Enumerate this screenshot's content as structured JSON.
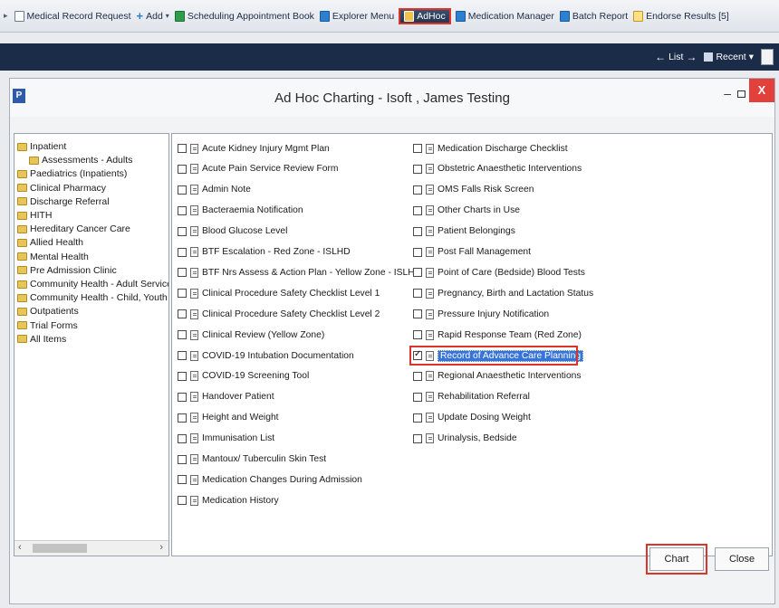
{
  "toolbar": {
    "items": [
      {
        "label": "Medical Record Request",
        "icon": "document-icon"
      },
      {
        "label": "Add",
        "icon": "plus-icon"
      },
      {
        "label": "Scheduling Appointment Book",
        "icon": "calendar-icon"
      },
      {
        "label": "Explorer Menu",
        "icon": "explorer-icon"
      },
      {
        "label": "AdHoc",
        "icon": "adhoc-icon",
        "highlighted": true
      },
      {
        "label": "Medication Manager",
        "icon": "medication-icon"
      },
      {
        "label": "Batch Report",
        "icon": "batch-report-icon"
      },
      {
        "label": "Endorse Results [5]",
        "icon": "endorse-icon"
      }
    ]
  },
  "navbar": {
    "list_label": "List",
    "recent_label": "Recent"
  },
  "dialog": {
    "title": "Ad Hoc Charting - Isoft , James Testing",
    "app_icon": "P",
    "minimize": "–",
    "close": "X"
  },
  "tree": {
    "items": [
      "Inpatient",
      "Assessments - Adults",
      "Paediatrics (Inpatients)",
      "Clinical Pharmacy",
      "Discharge Referral",
      "HITH",
      "Hereditary Cancer Care",
      "Allied Health",
      "Mental Health",
      "Pre Admission Clinic",
      "Community Health - Adult Services",
      "Community Health - Child, Youth an",
      "Outpatients",
      "Trial Forms",
      "All Items"
    ]
  },
  "forms_col1": [
    "Acute Kidney Injury Mgmt Plan",
    "Acute Pain Service Review Form",
    "Admin Note",
    "Bacteraemia Notification",
    "Blood Glucose Level",
    "BTF Escalation - Red Zone - ISLHD",
    "BTF Nrs Assess & Action Plan - Yellow Zone - ISLHD",
    "Clinical Procedure Safety Checklist Level 1",
    "Clinical Procedure Safety Checklist Level 2",
    "Clinical Review (Yellow Zone)",
    "COVID-19 Intubation Documentation",
    "COVID-19 Screening Tool",
    "Handover Patient",
    "Height and Weight",
    "Immunisation List",
    "Mantoux/ Tuberculin Skin Test",
    "Medication Changes During Admission",
    "Medication History"
  ],
  "forms_col2": [
    "Medication Discharge Checklist",
    "Obstetric Anaesthetic Interventions",
    "OMS Falls Risk Screen",
    "Other Charts in Use",
    "Patient Belongings",
    "Post Fall Management",
    "Point of Care (Bedside) Blood Tests",
    "Pregnancy, Birth and Lactation Status",
    "Pressure Injury Notification",
    "Rapid Response Team (Red Zone)",
    "Record of Advance Care Planning",
    "Regional Anaesthetic Interventions",
    "Rehabilitation Referral",
    "Update Dosing Weight",
    "Urinalysis, Bedside"
  ],
  "checked_item": "Record of Advance Care Planning",
  "buttons": {
    "chart": "Chart",
    "close": "Close"
  }
}
